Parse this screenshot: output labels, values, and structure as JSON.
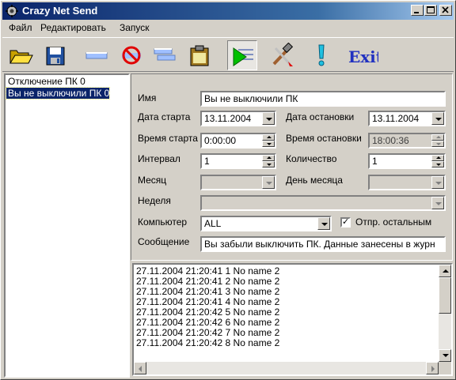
{
  "window": {
    "title": "Crazy Net Send"
  },
  "menu": [
    "Файл",
    "Редактировать",
    "Запуск"
  ],
  "toolbar": {
    "exit_label": "Exit",
    "exclamation": "!",
    "icons": [
      "open-folder-icon",
      "save-disk-icon",
      "new-item-icon",
      "delete-icon",
      "edit-item-icon",
      "clipboard-icon",
      "run-icon",
      "tools-icon",
      "info-icon",
      "exit-icon"
    ]
  },
  "tasks": [
    {
      "label": "Отключение ПК 0",
      "selected": false
    },
    {
      "label": "Вы не выключили ПК 0",
      "selected": true
    }
  ],
  "form": {
    "name_label": "Имя",
    "name_value": "Вы не выключили ПК",
    "start_date_label": "Дата старта",
    "start_date_value": "13.11.2004",
    "stop_date_label": "Дата остановки",
    "stop_date_value": "13.11.2004",
    "start_time_label": "Время старта",
    "start_time_value": "0:00:00",
    "stop_time_label": "Время остановки",
    "stop_time_value": "18:00:36",
    "interval_label": "Интервал",
    "interval_value": "1",
    "count_label": "Количество",
    "count_value": "1",
    "month_label": "Месяц",
    "month_value": "",
    "day_of_month_label": "День месяца",
    "day_of_month_value": "",
    "week_label": "Неделя",
    "week_value": "",
    "computer_label": "Компьютер",
    "computer_value": "ALL",
    "send_others_label": "Отпр. остальным",
    "send_others_checked": true,
    "message_label": "Сообщение",
    "message_value": "Вы забыли выключить ПК. Данные занесены в журн"
  },
  "log": [
    "27.11.2004 21:20:41 1 No name 2",
    "27.11.2004 21:20:41 2 No name 2",
    "27.11.2004 21:20:41 3 No name 2",
    "27.11.2004 21:20:41 4 No name 2",
    "27.11.2004 21:20:42 5 No name 2",
    "27.11.2004 21:20:42 6 No name 2",
    "27.11.2004 21:20:42 7 No name 2",
    "27.11.2004 21:20:42 8 No name 2"
  ]
}
